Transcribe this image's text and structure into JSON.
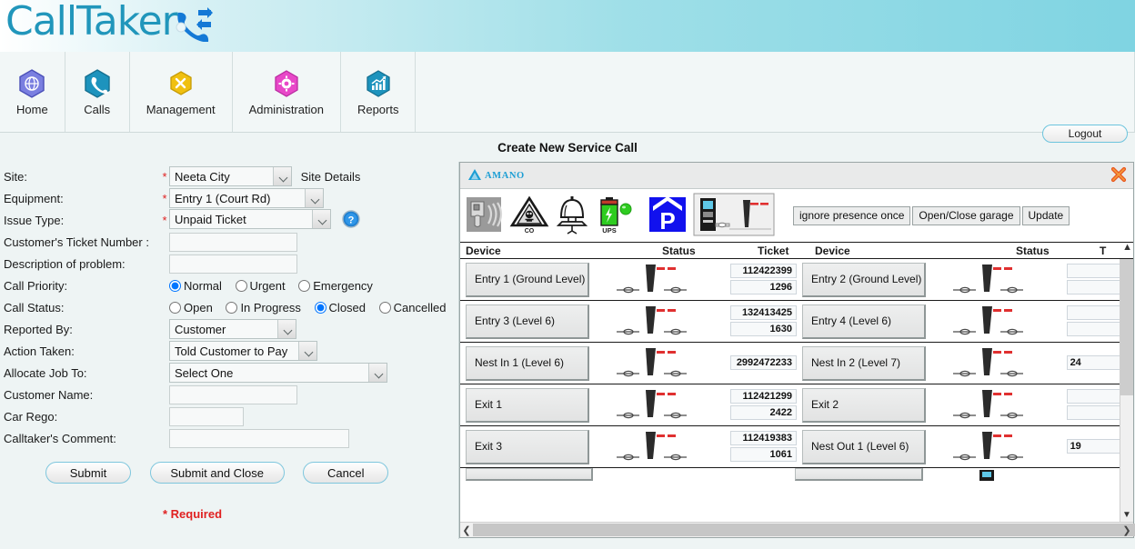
{
  "app": {
    "brand": "CallTaker",
    "brand_icon": "phone-transfer-icon"
  },
  "nav": {
    "items": [
      {
        "label": "Home",
        "icon": "globe-hex-icon",
        "color": "#6f74d6"
      },
      {
        "label": "Calls",
        "icon": "phone-hex-icon",
        "color": "#1d93bd"
      },
      {
        "label": "Management",
        "icon": "tools-hex-icon",
        "color": "#f0c010"
      },
      {
        "label": "Administration",
        "icon": "gear-hex-icon",
        "color": "#e848c8"
      },
      {
        "label": "Reports",
        "icon": "chart-hex-icon",
        "color": "#1d93bd"
      }
    ],
    "logout_label": "Logout"
  },
  "page": {
    "title": "Create New Service Call",
    "required_note": "* Required"
  },
  "form": {
    "required_marker": "*",
    "fields": {
      "site_label": "Site:",
      "site_value": "Neeta City",
      "site_details_link": "Site Details",
      "equipment_label": "Equipment:",
      "equipment_value": "Entry 1 (Court Rd)",
      "issue_type_label": "Issue Type:",
      "issue_type_value": "Unpaid Ticket",
      "ticket_number_label": "Customer's Ticket Number :",
      "ticket_number_value": "",
      "description_label": "Description of problem:",
      "description_value": "",
      "call_priority_label": "Call Priority:",
      "call_status_label": "Call Status:",
      "reported_by_label": "Reported By:",
      "reported_by_value": "Customer",
      "action_taken_label": "Action Taken:",
      "action_taken_value": "Told Customer to Pay",
      "allocate_label": "Allocate Job To:",
      "allocate_value": "Select One",
      "customer_name_label": "Customer Name:",
      "customer_name_value": "",
      "car_rego_label": "Car Rego:",
      "car_rego_value": "",
      "comment_label": "Calltaker's Comment:",
      "comment_value": ""
    },
    "call_priority": {
      "options": [
        "Normal",
        "Urgent",
        "Emergency"
      ],
      "selected": "Normal"
    },
    "call_status": {
      "options": [
        "Open",
        "In Progress",
        "Closed",
        "Cancelled"
      ],
      "selected": "Closed"
    },
    "buttons": {
      "submit": "Submit",
      "submit_close": "Submit and Close",
      "cancel": "Cancel"
    },
    "help_icon": "help-question-icon"
  },
  "device_panel": {
    "logo_text": "AMANO",
    "logo_icon": "amano-triangle-icon",
    "close_icon": "close-x-icon",
    "tool_icons": [
      "fire-alarm-pull-icon",
      "co-hazard-icon",
      "bell-alarm-icon",
      "ups-battery-icon",
      "parking-p-icon",
      "paystation-barrier-icon"
    ],
    "command_buttons": [
      "ignore presence once",
      "Open/Close garage",
      "Update"
    ],
    "columns": [
      "Device",
      "Status",
      "Ticket",
      "Device",
      "Status",
      "T"
    ],
    "rows": [
      {
        "left": {
          "device": "Entry 1 (Ground Level)",
          "status_icon": "barrier-gate-icon",
          "ticket_top": "112422399",
          "ticket_bottom": "1296"
        },
        "right": {
          "device": "Entry 2 (Ground Level)",
          "status_icon": "barrier-gate-icon",
          "ticket_top": "",
          "ticket_bottom": ""
        }
      },
      {
        "left": {
          "device": "Entry 3 (Level 6)",
          "status_icon": "barrier-gate-icon",
          "ticket_top": "132413425",
          "ticket_bottom": "1630"
        },
        "right": {
          "device": "Entry 4 (Level 6)",
          "status_icon": "barrier-gate-icon",
          "ticket_top": "",
          "ticket_bottom": ""
        }
      },
      {
        "left": {
          "device": "Nest In 1 (Level 6)",
          "status_icon": "barrier-gate-icon",
          "ticket_top": "2992472233",
          "ticket_bottom": ""
        },
        "right": {
          "device": "Nest In 2 (Level 7)",
          "status_icon": "barrier-gate-icon",
          "ticket_top": "24",
          "ticket_bottom": ""
        }
      },
      {
        "left": {
          "device": "Exit 1",
          "status_icon": "barrier-gate-icon",
          "ticket_top": "112421299",
          "ticket_bottom": "2422"
        },
        "right": {
          "device": "Exit 2",
          "status_icon": "barrier-gate-icon",
          "ticket_top": "",
          "ticket_bottom": ""
        }
      },
      {
        "left": {
          "device": "Exit 3",
          "status_icon": "barrier-gate-icon",
          "ticket_top": "112419383",
          "ticket_bottom": "1061"
        },
        "right": {
          "device": "Nest Out 1 (Level 6)",
          "status_icon": "barrier-gate-icon",
          "ticket_top": "19",
          "ticket_bottom": ""
        }
      }
    ],
    "scroll_up_icon": "chevron-up-icon",
    "scroll_down_icon": "chevron-down-icon",
    "scroll_left_icon": "chevron-left-icon",
    "scroll_right_icon": "chevron-right-icon"
  }
}
